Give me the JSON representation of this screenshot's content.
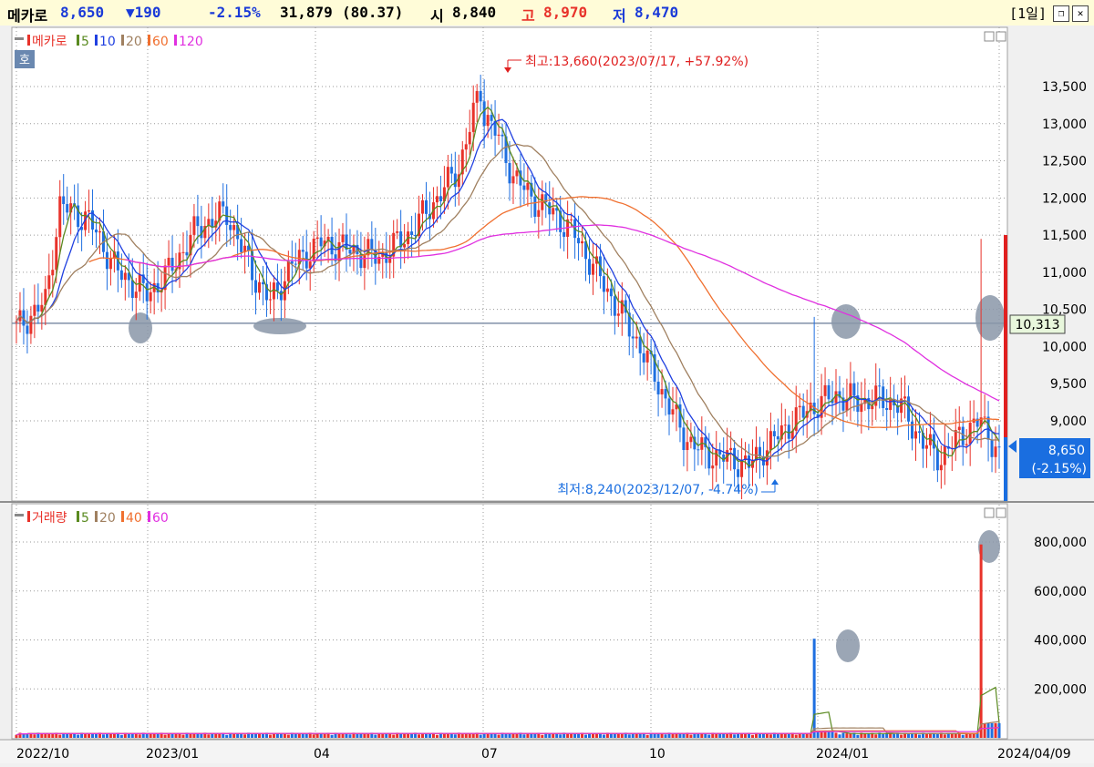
{
  "header": {
    "name": "메카로",
    "price": "8,650",
    "change": "▼190",
    "change_pct": "-2.15%",
    "volume": "31,879",
    "volume_ratio": "(80.37)",
    "open_label": "시",
    "open": "8,840",
    "high_label": "고",
    "high": "8,970",
    "low_label": "저",
    "low": "8,470",
    "period": "[1일]"
  },
  "colors": {
    "up": "#e8322a",
    "down": "#1f6fe0",
    "ma5": "#5a8a20",
    "ma10": "#2040e0",
    "ma20": "#a08060",
    "ma60": "#f07030",
    "ma120": "#e030e0",
    "volume_ma40": "#f07030"
  },
  "price_panel": {
    "legend": [
      {
        "label": "메카로",
        "color": "#e8322a"
      },
      {
        "label": "5",
        "color": "#5a8a20"
      },
      {
        "label": "10",
        "color": "#2040e0"
      },
      {
        "label": "20",
        "color": "#a08060"
      },
      {
        "label": "60",
        "color": "#f07030"
      },
      {
        "label": "120",
        "color": "#e030e0"
      }
    ],
    "badge": "호",
    "high_note": "최고:13,660(2023/07/17, +57.92%)",
    "low_note": "최저:8,240(2023/12/07, -4.74%)",
    "ref_value": "10,313",
    "cur_price": "8,650",
    "cur_pct": "(-2.15%)"
  },
  "volume_panel": {
    "legend": [
      {
        "label": "거래량",
        "color": "#e8322a"
      },
      {
        "label": "5",
        "color": "#5a8a20"
      },
      {
        "label": "20",
        "color": "#a08060"
      },
      {
        "label": "40",
        "color": "#f07030"
      },
      {
        "label": "60",
        "color": "#e030e0"
      }
    ]
  },
  "chart_data": [
    {
      "type": "candlestick",
      "x_ticks": [
        "2022/10",
        "2023/01",
        "04",
        "07",
        "10",
        "2024/01",
        "2024/04/09"
      ],
      "y_ticks": [
        9000,
        9500,
        10000,
        10500,
        11000,
        11500,
        12000,
        12500,
        13000,
        13500
      ],
      "ylim": [
        8000,
        13900
      ],
      "reference_line": 10313,
      "highest": {
        "value": 13660,
        "date": "2023/07/17",
        "pct": "+57.92%"
      },
      "lowest": {
        "value": 8240,
        "date": "2023/12/07",
        "pct": "-4.74%"
      },
      "last_close": 8650,
      "close_anchors": [
        [
          0,
          10250
        ],
        [
          8,
          10600
        ],
        [
          12,
          11900
        ],
        [
          20,
          11700
        ],
        [
          28,
          11000
        ],
        [
          36,
          10700
        ],
        [
          42,
          11000
        ],
        [
          50,
          11600
        ],
        [
          58,
          11800
        ],
        [
          65,
          11000
        ],
        [
          70,
          10600
        ],
        [
          76,
          11100
        ],
        [
          84,
          11400
        ],
        [
          92,
          11300
        ],
        [
          100,
          11200
        ],
        [
          108,
          11500
        ],
        [
          116,
          12000
        ],
        [
          122,
          12400
        ],
        [
          127,
          13300
        ],
        [
          132,
          12900
        ],
        [
          137,
          12300
        ],
        [
          142,
          12000
        ],
        [
          148,
          11800
        ],
        [
          154,
          11500
        ],
        [
          160,
          11000
        ],
        [
          166,
          10500
        ],
        [
          172,
          10000
        ],
        [
          178,
          9400
        ],
        [
          184,
          8800
        ],
        [
          190,
          8550
        ],
        [
          196,
          8500
        ],
        [
          202,
          8400
        ],
        [
          208,
          8700
        ],
        [
          214,
          9000
        ],
        [
          220,
          9200
        ],
        [
          226,
          9350
        ],
        [
          232,
          9250
        ],
        [
          238,
          9300
        ],
        [
          244,
          9200
        ],
        [
          250,
          8700
        ],
        [
          255,
          8500
        ],
        [
          260,
          8800
        ],
        [
          266,
          9000
        ],
        [
          270,
          8650
        ]
      ]
    },
    {
      "type": "bar",
      "name": "거래량",
      "y_ticks": [
        200000,
        400000,
        600000,
        800000
      ],
      "ylim": [
        0,
        860000
      ],
      "spikes": [
        [
          220,
          405000
        ],
        [
          266,
          790000
        ]
      ],
      "baseline_volume": 12000
    }
  ]
}
